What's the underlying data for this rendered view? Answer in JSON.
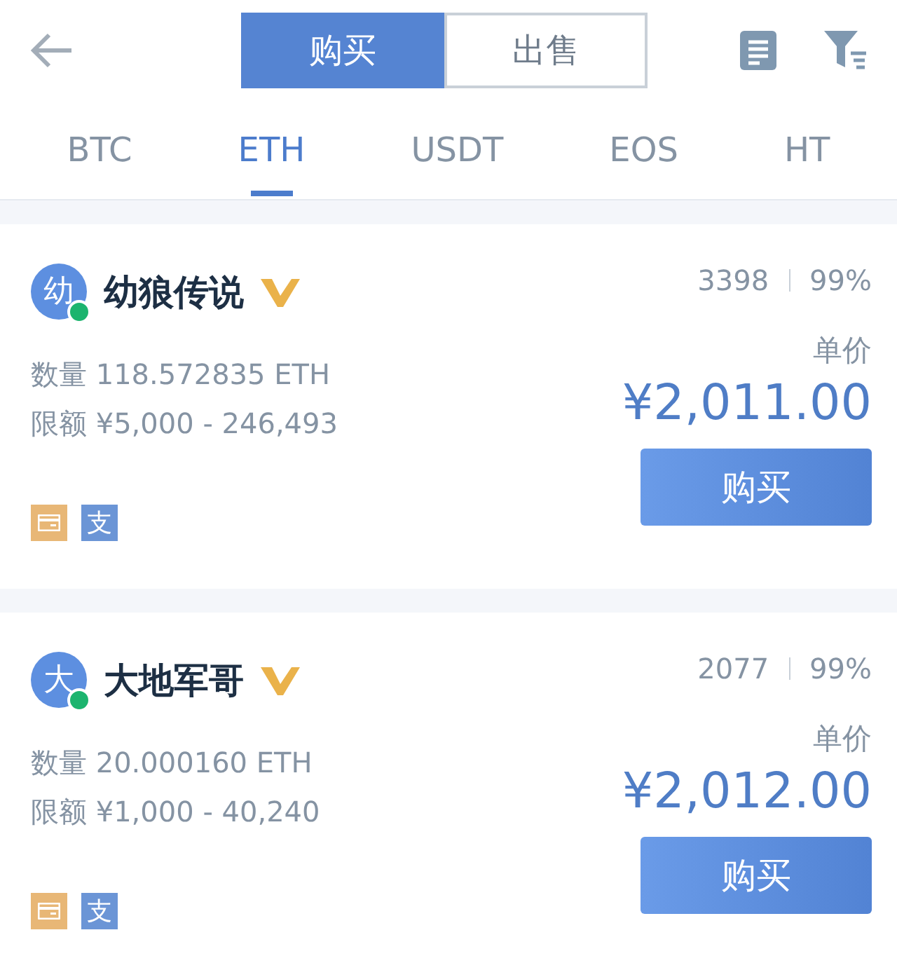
{
  "mode_tabs": [
    {
      "label": "购买",
      "selected": true
    },
    {
      "label": "出售",
      "selected": false
    }
  ],
  "coin_tabs": [
    {
      "label": "BTC",
      "selected": false
    },
    {
      "label": "ETH",
      "selected": true
    },
    {
      "label": "USDT",
      "selected": false
    },
    {
      "label": "EOS",
      "selected": false
    },
    {
      "label": "HT",
      "selected": false
    }
  ],
  "offers": [
    {
      "avatar": "幼",
      "online": true,
      "name": "幼狼传说",
      "verified": true,
      "orders": "3398",
      "rate": "99%",
      "quantity_label": "数量",
      "quantity": "118.572835  ETH",
      "limit_label": "限额",
      "limit": "¥5,000 - 246,493",
      "price_label": "单价",
      "price": "¥2,011.00",
      "button": "购买",
      "payments": [
        {
          "kind": "card"
        },
        {
          "kind": "alipay",
          "label": "支"
        }
      ]
    },
    {
      "avatar": "大",
      "online": true,
      "name": "大地军哥",
      "verified": true,
      "orders": "2077",
      "rate": "99%",
      "quantity_label": "数量",
      "quantity": "20.000160  ETH",
      "limit_label": "限额",
      "limit": "¥1,000 - 40,240",
      "price_label": "单价",
      "price": "¥2,012.00",
      "button": "购买",
      "payments": [
        {
          "kind": "card"
        },
        {
          "kind": "alipay",
          "label": "支"
        }
      ]
    }
  ]
}
